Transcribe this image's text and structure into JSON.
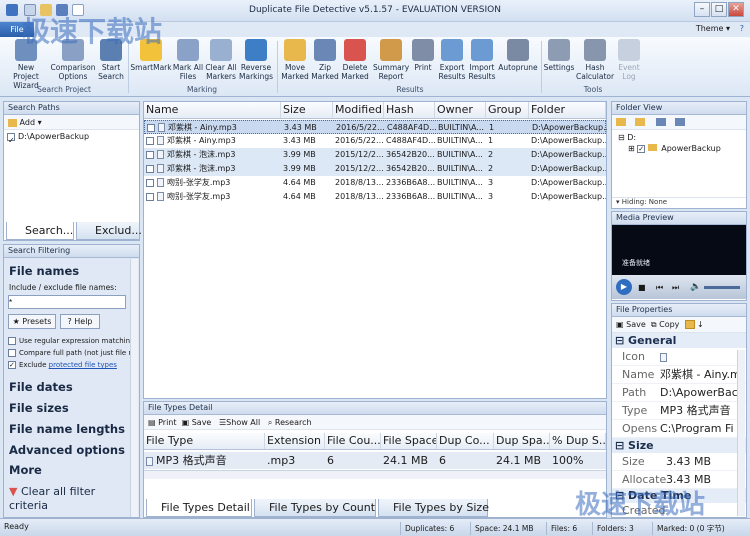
{
  "window": {
    "title": "Duplicate File Detective v5.1.57 - EVALUATION VERSION",
    "min": "–",
    "max": "□",
    "close": "✕"
  },
  "menubar": {
    "file_tab": "File",
    "theme_label": "Theme ▾",
    "help": "?"
  },
  "ribbon": {
    "buttons": [
      {
        "label": "New Project Wizard",
        "icon": "wand-icon",
        "color": "#6f8fbf"
      },
      {
        "label": "Comparison Options",
        "icon": "options-icon",
        "color": "#8aa0c4"
      },
      {
        "label": "Start Search",
        "icon": "search-icon",
        "color": "#5a7fb0"
      },
      {
        "label": "SmartMark",
        "icon": "lightbulb-icon",
        "color": "#f2c23a"
      },
      {
        "label": "Mark All Files",
        "icon": "mark-files-icon",
        "color": "#8aa2c8"
      },
      {
        "label": "Clear All Markers",
        "icon": "clear-markers-icon",
        "color": "#9ab0d0"
      },
      {
        "label": "Reverse Markings",
        "icon": "reverse-icon",
        "color": "#3d7ec6"
      },
      {
        "label": "Move Marked",
        "icon": "move-folder-icon",
        "color": "#e9b84c"
      },
      {
        "label": "Zip Marked",
        "icon": "zip-icon",
        "color": "#6b87b5"
      },
      {
        "label": "Delete Marked",
        "icon": "delete-icon",
        "color": "#d9534f"
      },
      {
        "label": "Summary Report",
        "icon": "report-icon",
        "color": "#d1994a"
      },
      {
        "label": "Print",
        "icon": "printer-icon",
        "color": "#7f8ea6"
      },
      {
        "label": "Export Results",
        "icon": "export-icon",
        "color": "#6b9bd2"
      },
      {
        "label": "Import Results",
        "icon": "import-icon",
        "color": "#6b9bd2"
      },
      {
        "label": "Autoprune",
        "icon": "scissors-icon",
        "color": "#7b8aa3"
      },
      {
        "label": "Settings",
        "icon": "settings-icon",
        "color": "#8e9cb3"
      },
      {
        "label": "Hash Calculator",
        "icon": "calculator-icon",
        "color": "#8796ad"
      },
      {
        "label": "Event Log",
        "icon": "event-log-icon",
        "color": "#c6d0de"
      }
    ],
    "groups": [
      "Search Project",
      "Marking",
      "Results",
      "Tools"
    ]
  },
  "search_paths": {
    "title": "Search Paths",
    "add": "Add",
    "path": "D:\\ApowerBackup",
    "tab1": "Search...",
    "tab2": "Exclud..."
  },
  "search_filtering": {
    "title": "Search Filtering",
    "file_names": "File names",
    "include_label": "Include / exclude file names:",
    "input_value": "*",
    "presets": "Presets",
    "help": "Help",
    "opt1": "Use regular expression matching",
    "opt2": "Compare full path (not just file nar",
    "opt3_prefix": "Exclude ",
    "opt3_link": "protected file types",
    "sections": [
      "File dates",
      "File sizes",
      "File name lengths",
      "Advanced options",
      "More"
    ],
    "clear": "Clear all filter criteria"
  },
  "results": {
    "columns": [
      "Name",
      "Size",
      "Modified",
      "Hash",
      "Owner",
      "Group",
      "Folder"
    ],
    "rows": [
      {
        "name": "邓紫棋 - Ainy.mp3",
        "size": "3.43 MB",
        "modified": "2016/5/22...",
        "hash": "C488AF4D...",
        "owner": "BUILTIN\\A...",
        "group": "1",
        "folder": "D:\\ApowerBackup..."
      },
      {
        "name": "邓紫棋 - Ainy.mp3",
        "size": "3.43 MB",
        "modified": "2016/5/22...",
        "hash": "C488AF4D...",
        "owner": "BUILTIN\\A...",
        "group": "1",
        "folder": "D:\\ApowerBackup..."
      },
      {
        "name": "邓紫棋 - 泡沫.mp3",
        "size": "3.99 MB",
        "modified": "2015/12/2...",
        "hash": "36542B20...",
        "owner": "BUILTIN\\A...",
        "group": "2",
        "folder": "D:\\ApowerBackup..."
      },
      {
        "name": "邓紫棋 - 泡沫.mp3",
        "size": "3.99 MB",
        "modified": "2015/12/2...",
        "hash": "36542B20...",
        "owner": "BUILTIN\\A...",
        "group": "2",
        "folder": "D:\\ApowerBackup..."
      },
      {
        "name": "吻别-张学友.mp3",
        "size": "4.64 MB",
        "modified": "2018/8/13...",
        "hash": "2336B6A8...",
        "owner": "BUILTIN\\A...",
        "group": "3",
        "folder": "D:\\ApowerBackup..."
      },
      {
        "name": "吻别-张学友.mp3",
        "size": "4.64 MB",
        "modified": "2018/8/13...",
        "hash": "2336B6A8...",
        "owner": "BUILTIN\\A...",
        "group": "3",
        "folder": "D:\\ApowerBackup..."
      }
    ]
  },
  "file_types": {
    "title": "File Types Detail",
    "print": "Print",
    "save": "Save",
    "show_all": "Show All",
    "research": "Research",
    "columns": [
      "File Type",
      "Extension",
      "File Cou...",
      "File Space",
      "Dup Co...",
      "Dup Spa...",
      "% Dup S..."
    ],
    "row": {
      "type": "MP3 格式声音",
      "ext": ".mp3",
      "count": "6",
      "space": "24.1 MB",
      "dup_count": "6",
      "dup_space": "24.1 MB",
      "pct": "100%"
    },
    "tabs": [
      "File Types Detail",
      "File Types by Count",
      "File Types by Size"
    ]
  },
  "folder_view": {
    "title": "Folder View",
    "drive": "D:",
    "folder": "ApowerBackup",
    "hiding": "Hiding: None"
  },
  "media_preview": {
    "title": "Media Preview",
    "caption": "准备就绪"
  },
  "file_properties": {
    "title": "File Properties",
    "save": "Save",
    "copy": "Copy",
    "general": "General",
    "props": [
      {
        "k": "Icon",
        "v": ""
      },
      {
        "k": "Name",
        "v": "邓紫棋 - Ainy.m"
      },
      {
        "k": "Path",
        "v": "D:\\ApowerBac"
      },
      {
        "k": "Type",
        "v": "MP3 格式声音"
      },
      {
        "k": "Opens",
        "v": "C:\\Program Fi"
      }
    ],
    "size_section": "Size",
    "size_props": [
      {
        "k": "Size",
        "v": "3.43 MB"
      },
      {
        "k": "Allocate",
        "v": "3.43 MB"
      }
    ],
    "more_section": "Date Time",
    "more_prop": "Created"
  },
  "status": {
    "ready": "Ready",
    "duplicates": "Duplicates: 6",
    "space": "Space: 24.1 MB",
    "files": "Files: 6",
    "folders": "Folders: 3",
    "marked": "Marked: 0 (0 字节)"
  },
  "watermark": "极速下载站"
}
